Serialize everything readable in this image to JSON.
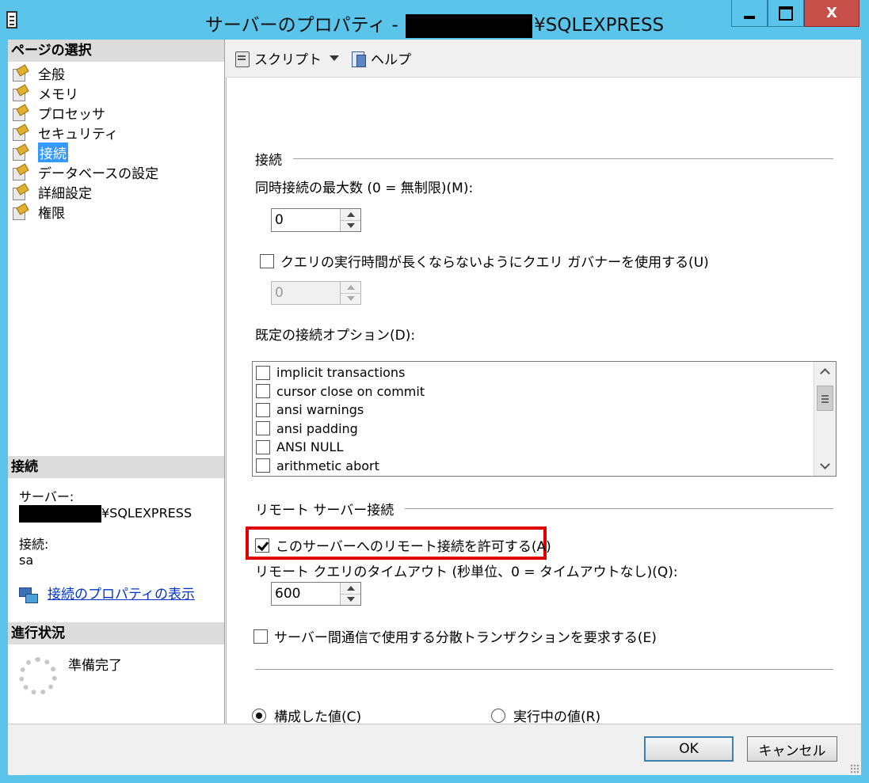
{
  "window": {
    "title_prefix": "サーバーのプロパティ - ",
    "title_suffix": "¥SQLEXPRESS",
    "close_glyph": "X"
  },
  "left": {
    "page_select_title": "ページの選択",
    "pages": [
      {
        "label": "全般"
      },
      {
        "label": "メモリ"
      },
      {
        "label": "プロセッサ"
      },
      {
        "label": "セキュリティ"
      },
      {
        "label": "接続"
      },
      {
        "label": "データベースの設定"
      },
      {
        "label": "詳細設定"
      },
      {
        "label": "権限"
      }
    ],
    "selected_index": 4,
    "connection": {
      "title": "接続",
      "server_label": "サーバー:",
      "server_suffix": "¥SQLEXPRESS",
      "conn_label": "接続:",
      "conn_value": "sa",
      "link": "接続のプロパティの表示"
    },
    "progress": {
      "title": "進行状況",
      "status": "準備完了"
    }
  },
  "toolbar": {
    "script_label": "スクリプト",
    "help_label": "ヘルプ"
  },
  "form": {
    "connection_group": "接続",
    "max_conn_label": "同時接続の最大数 (0 = 無制限)(M):",
    "max_conn_value": "0",
    "governor_label": "クエリの実行時間が長くならないようにクエリ ガバナーを使用する(U)",
    "governor_checked": false,
    "governor_value": "0",
    "default_options_label": "既定の接続オプション(D):",
    "options": [
      {
        "label": "implicit transactions",
        "checked": false
      },
      {
        "label": "cursor close on commit",
        "checked": false
      },
      {
        "label": "ansi warnings",
        "checked": false
      },
      {
        "label": "ansi padding",
        "checked": false
      },
      {
        "label": "ANSI NULL",
        "checked": false
      },
      {
        "label": "arithmetic abort",
        "checked": false
      }
    ],
    "remote_group": "リモート サーバー接続",
    "allow_remote_label": "このサーバーへのリモート接続を許可する(A)",
    "allow_remote_checked": true,
    "remote_timeout_label": "リモート クエリのタイムアウト (秒単位、0 = タイムアウトなし)(Q):",
    "remote_timeout_value": "600",
    "distributed_label": "サーバー間通信で使用する分散トランザクションを要求する(E)",
    "distributed_checked": false,
    "configured_label": "構成した値(C)",
    "running_label": "実行中の値(R)",
    "selected_value_mode": "configured"
  },
  "buttons": {
    "ok": "OK",
    "cancel": "キャンセル"
  },
  "colors": {
    "title_bar": "#5bc4ea",
    "close_button": "#c7504a",
    "selection": "#3399ff",
    "highlight_box": "#e00000",
    "link": "#0033cc"
  }
}
